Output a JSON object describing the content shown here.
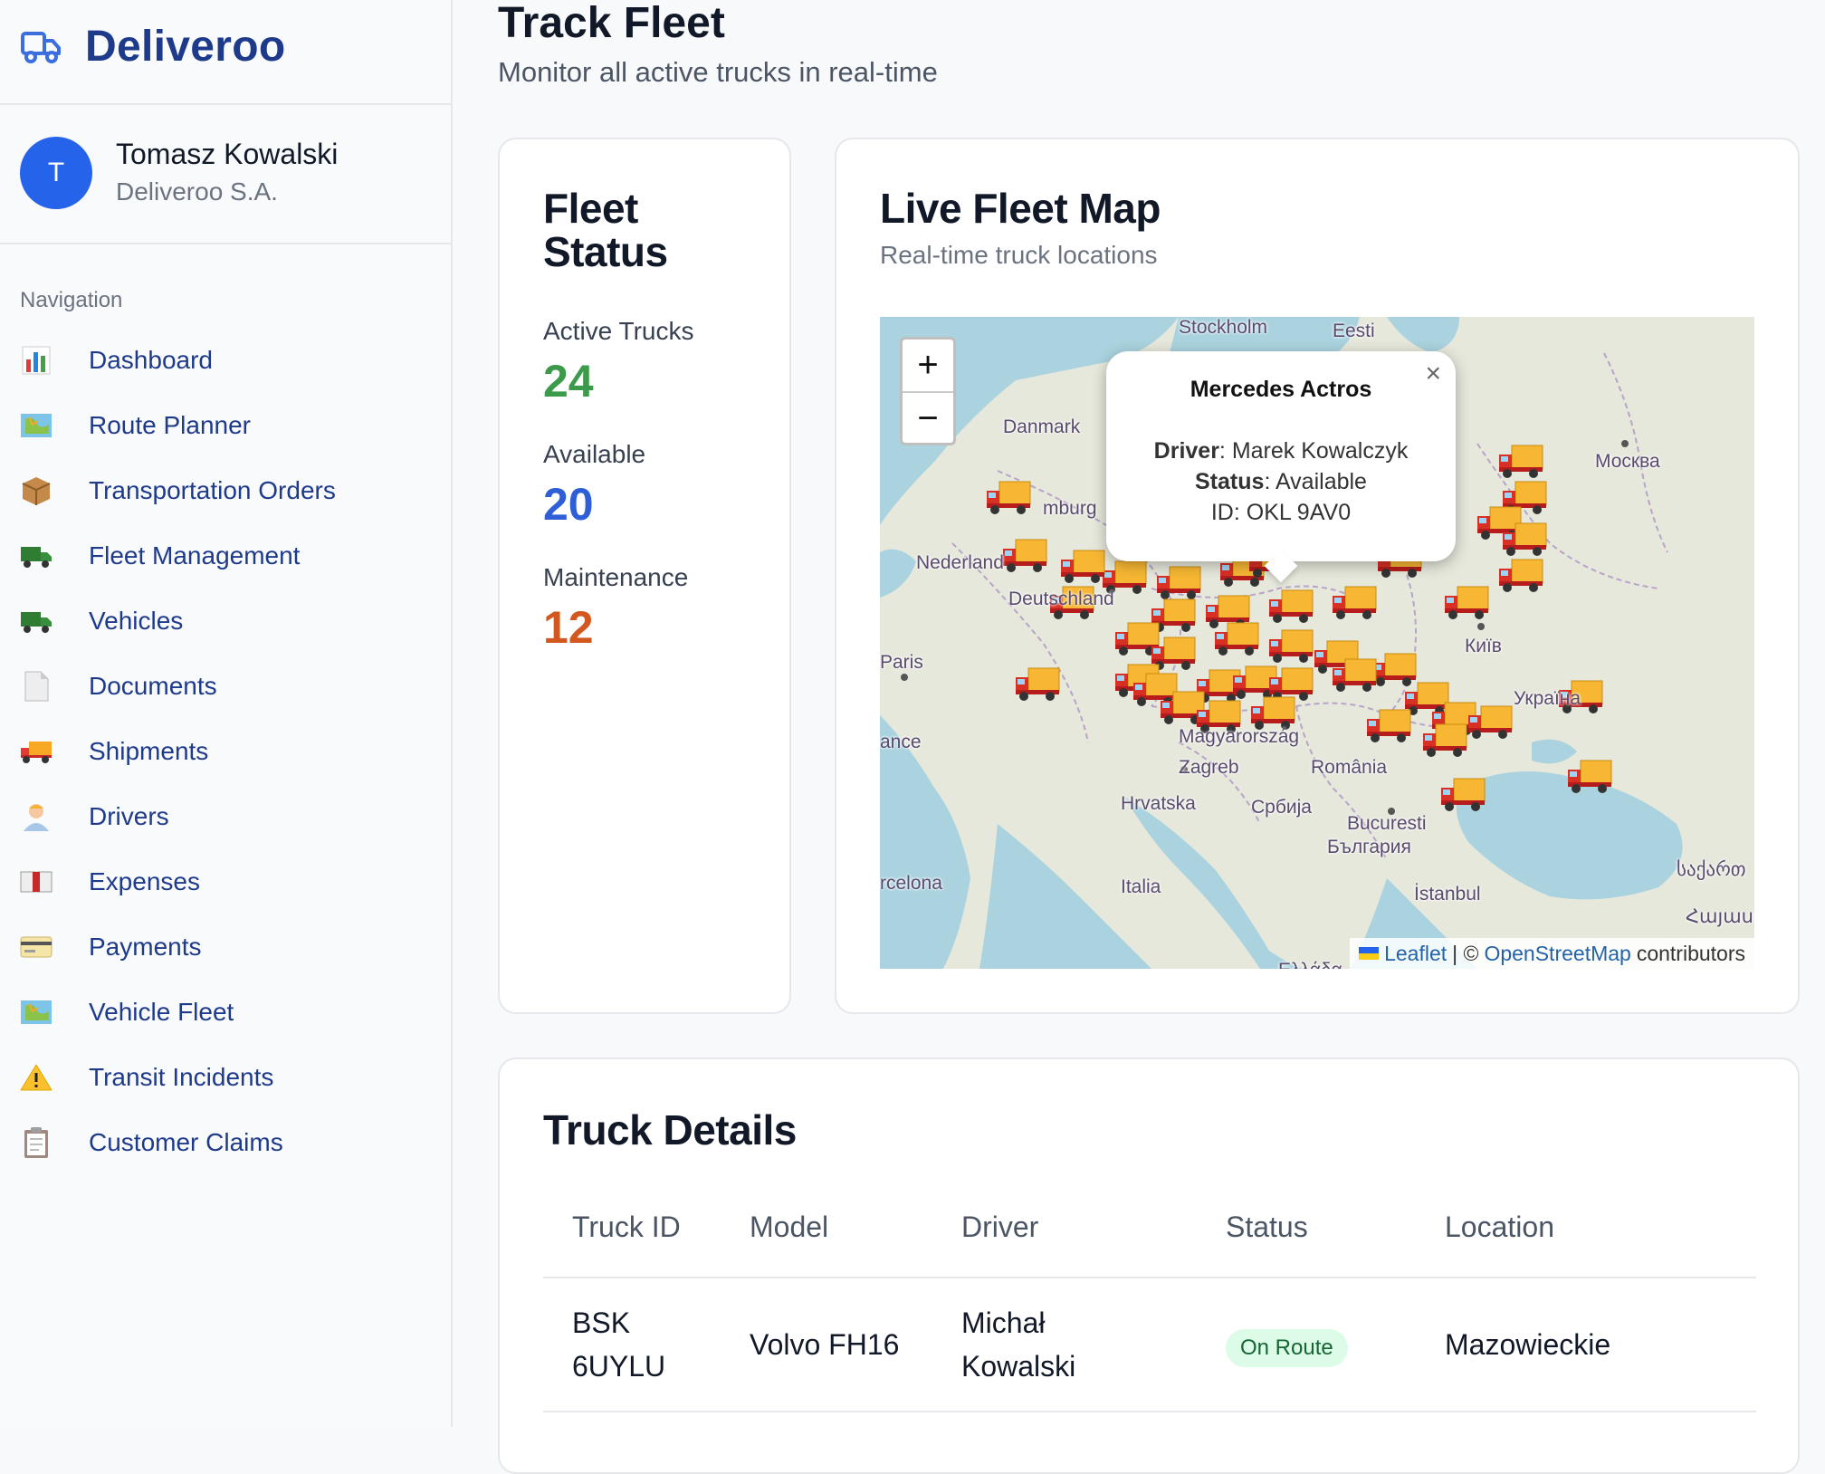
{
  "brand": {
    "name": "Deliveroo"
  },
  "user": {
    "initial": "T",
    "name": "Tomasz Kowalski",
    "company": "Deliveroo S.A."
  },
  "nav": {
    "heading": "Navigation",
    "items": [
      {
        "label": "Dashboard",
        "icon": "bar-chart-icon"
      },
      {
        "label": "Route Planner",
        "icon": "map-icon"
      },
      {
        "label": "Transportation Orders",
        "icon": "package-icon"
      },
      {
        "label": "Fleet Management",
        "icon": "truck-icon"
      },
      {
        "label": "Vehicles",
        "icon": "truck-icon"
      },
      {
        "label": "Documents",
        "icon": "document-icon"
      },
      {
        "label": "Shipments",
        "icon": "delivery-truck-icon"
      },
      {
        "label": "Drivers",
        "icon": "driver-icon"
      },
      {
        "label": "Expenses",
        "icon": "ledger-icon"
      },
      {
        "label": "Payments",
        "icon": "credit-card-icon"
      },
      {
        "label": "Vehicle Fleet",
        "icon": "map-icon"
      },
      {
        "label": "Transit Incidents",
        "icon": "warning-icon"
      },
      {
        "label": "Customer Claims",
        "icon": "clipboard-icon"
      }
    ]
  },
  "header": {
    "title": "Track Fleet",
    "subtitle": "Monitor all active trucks in real-time"
  },
  "fleet_status": {
    "title_line1": "Fleet",
    "title_line2": "Status",
    "active_label": "Active Trucks",
    "active_value": "24",
    "active_color": "#3c9a4b",
    "available_label": "Available",
    "available_value": "20",
    "available_color": "#2f5fd6",
    "maintenance_label": "Maintenance",
    "maintenance_value": "12",
    "maintenance_color": "#d2581f"
  },
  "map": {
    "title": "Live Fleet Map",
    "subtitle": "Real-time truck locations",
    "zoom_in": "+",
    "zoom_out": "−",
    "labels": [
      "Stockholm",
      "Eesti",
      "Danmark",
      "Москва",
      "mburg",
      "Nederland",
      "Deutschland",
      "Київ",
      "Paris",
      "Україна",
      "ance",
      "Magyarország",
      "Zagreb",
      "România",
      "Hrvatska",
      "Србија",
      "Bucuresti",
      "България",
      "rcelona",
      "Italia",
      "İstanbul",
      "საქართ",
      "Հայաստ",
      "Ελλάδα"
    ],
    "popup": {
      "title": "Mercedes Actros",
      "driver_label": "Driver",
      "driver": "Marek Kowalczyk",
      "status_label": "Status",
      "status": "Available",
      "id_label": "ID",
      "id": "OKL 9AV0",
      "close": "×"
    },
    "attribution": {
      "leaflet": "Leaflet",
      "separator": "| ©",
      "osm": "OpenStreetMap",
      "suffix": "contributors"
    }
  },
  "details": {
    "title": "Truck Details",
    "columns": [
      "Truck ID",
      "Model",
      "Driver",
      "Status",
      "Location"
    ],
    "rows": [
      {
        "id_line1": "BSK",
        "id_line2": "6UYLU",
        "model": "Volvo FH16",
        "driver_line1": "Michał",
        "driver_line2": "Kowalski",
        "status": "On Route",
        "location": "Mazowieckie"
      }
    ]
  }
}
